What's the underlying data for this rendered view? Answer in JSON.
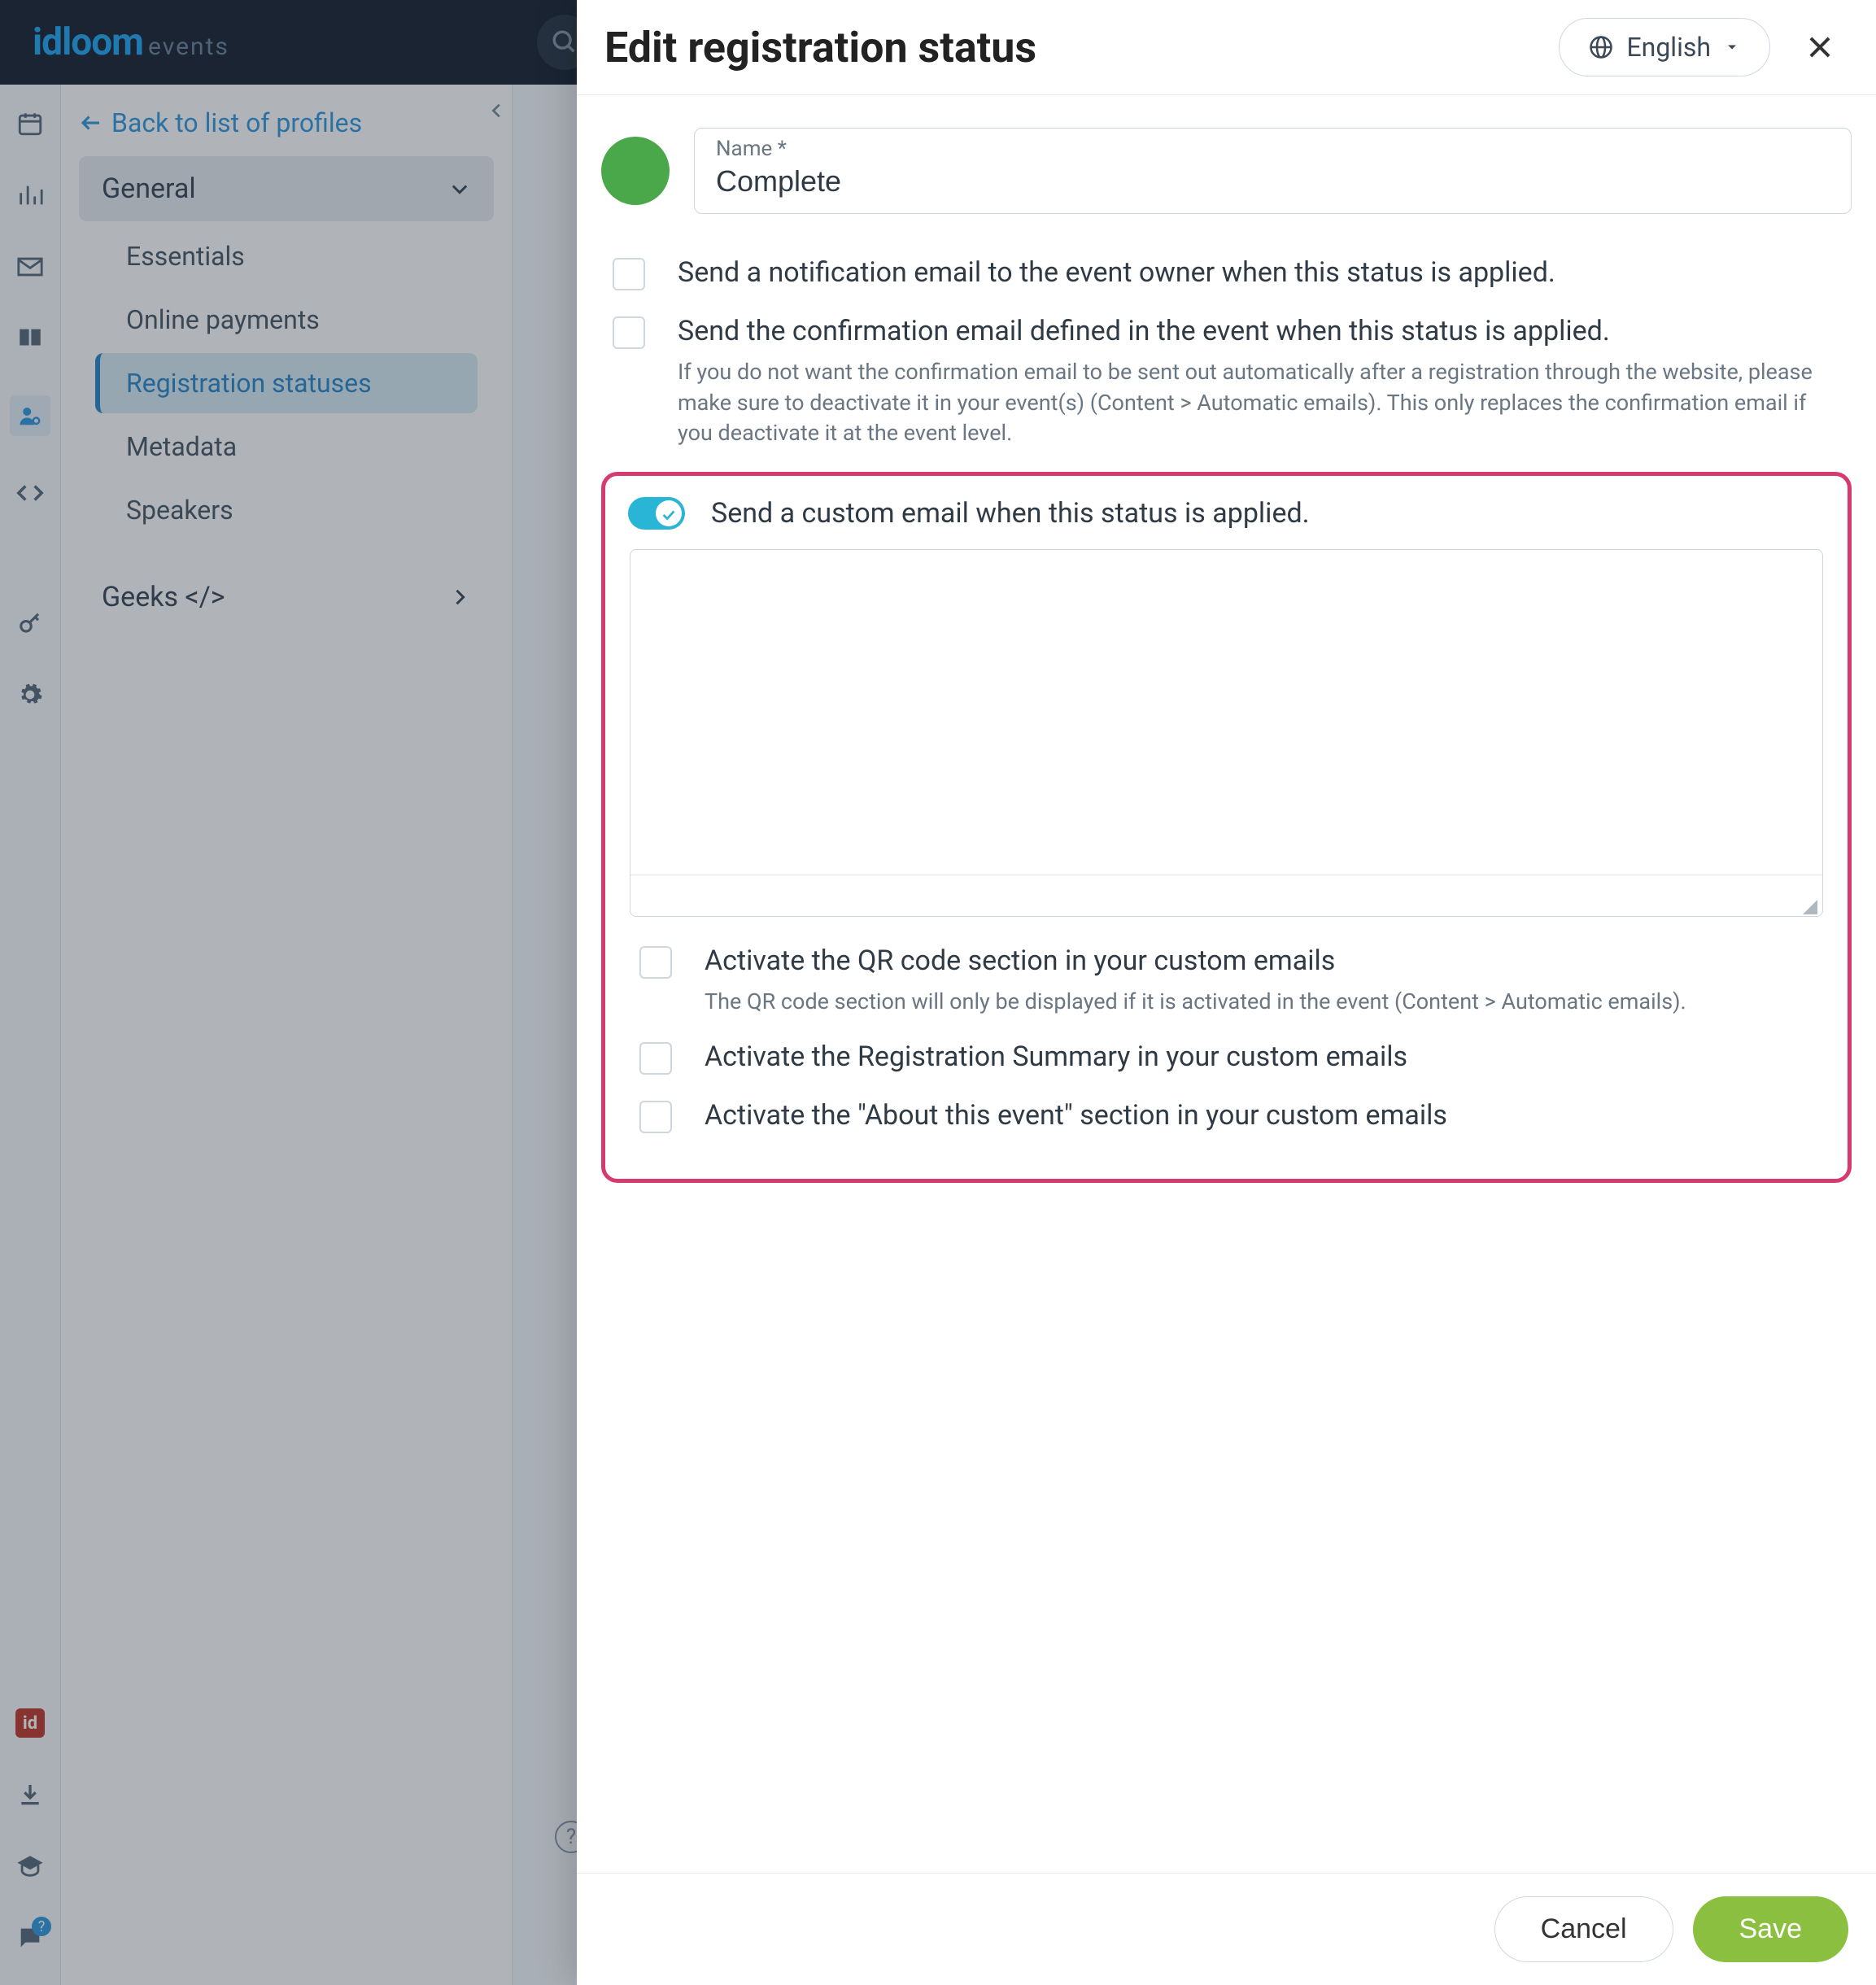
{
  "brand": {
    "name": "idloom",
    "suffix": "events"
  },
  "sidebar": {
    "back_label": "Back to list of profiles",
    "group_general": "General",
    "items": [
      "Essentials",
      "Online payments",
      "Registration statuses",
      "Metadata",
      "Speakers"
    ],
    "group_geeks": "Geeks </>"
  },
  "modal": {
    "title": "Edit registration status",
    "language": "English",
    "name_label": "Name *",
    "name_value": "Complete",
    "chk_notify_owner": "Send a notification email to the event owner when this status is applied.",
    "chk_confirmation": "Send the confirmation email defined in the event when this status is applied.",
    "chk_confirmation_help": "If you do not want the confirmation email to be sent out automatically after a registration through the website, please make sure to deactivate it in your event(s) (Content > Automatic emails). This only replaces the confirmation email if you deactivate it at the event level.",
    "toggle_custom_email": "Send a custom email when this status is applied.",
    "chk_qr": "Activate the QR code section in your custom emails",
    "chk_qr_help": "The QR code section will only be displayed if it is activated in the event (Content > Automatic emails).",
    "chk_reg_summary": "Activate the Registration Summary in your custom emails",
    "chk_about": "Activate the \"About this event\" section in your custom emails",
    "cancel": "Cancel",
    "save": "Save"
  }
}
